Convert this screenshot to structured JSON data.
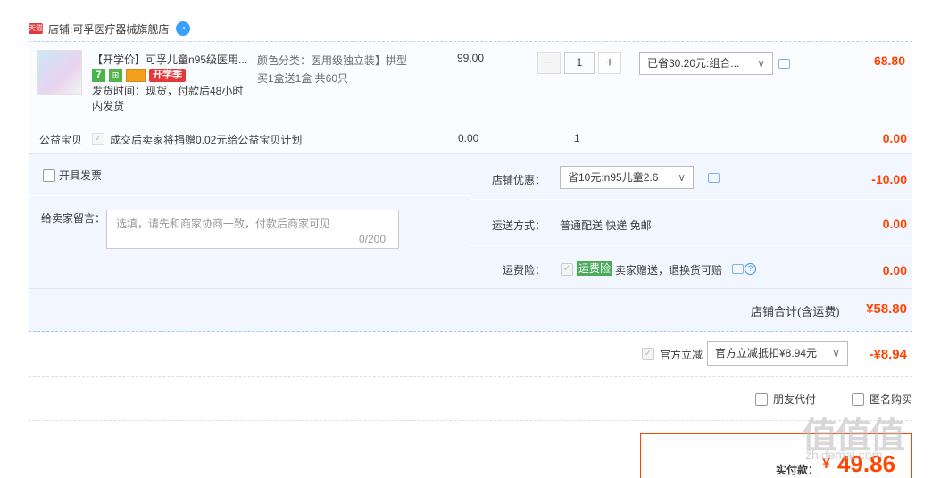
{
  "shop": {
    "label": "店铺:",
    "name": "可孚医疗器械旗舰店",
    "badge": "天猫"
  },
  "item": {
    "title": "【开学价】可孚儿童n95级医用...",
    "badges": {
      "seven": "7",
      "season": "开学季"
    },
    "ship_time": "发货时间：现货，付款后48小时内发货",
    "sku_line1": "颜色分类：医用级独立装】拱型",
    "sku_line2": "买1盒送1盒 共60只",
    "unit_price": "99.00",
    "quantity": "1",
    "promo": "已省30.20元:组合...",
    "total": "68.80"
  },
  "charity": {
    "label": "公益宝贝",
    "text": "成交后卖家将捐赠0.02元给公益宝贝计划",
    "price": "0.00",
    "qty": "1",
    "total": "0.00"
  },
  "options": {
    "invoice_label": "开具发票",
    "note_label": "给卖家留言：",
    "note_placeholder": "选填，请先和商家协商一致，付款后商家可见",
    "note_count": "0/200",
    "discount_label": "店铺优惠：",
    "discount_value": "省10元:n95儿童2.6",
    "discount_amount": "-10.00",
    "delivery_label": "运送方式：",
    "delivery_text": "普通配送 快递 免邮",
    "delivery_amount": "0.00",
    "insurance_label": "运费险：",
    "insurance_tag": "运费险",
    "insurance_text": "卖家赠送，退换货可赔",
    "insurance_amount": "0.00"
  },
  "shop_total": {
    "label": "店铺合计(含运费)",
    "value": "¥58.80"
  },
  "official": {
    "label": "官方立减",
    "select": "官方立减抵扣¥8.94元",
    "amount": "-¥8.94"
  },
  "extras": {
    "friend_pay": "朋友代付",
    "anonymous": "匿名购买"
  },
  "payment": {
    "label": "实付款：",
    "currency": "¥",
    "value": "49.86"
  },
  "watermark": {
    "logo": "值值值",
    "sub": "zhidemai.com"
  }
}
